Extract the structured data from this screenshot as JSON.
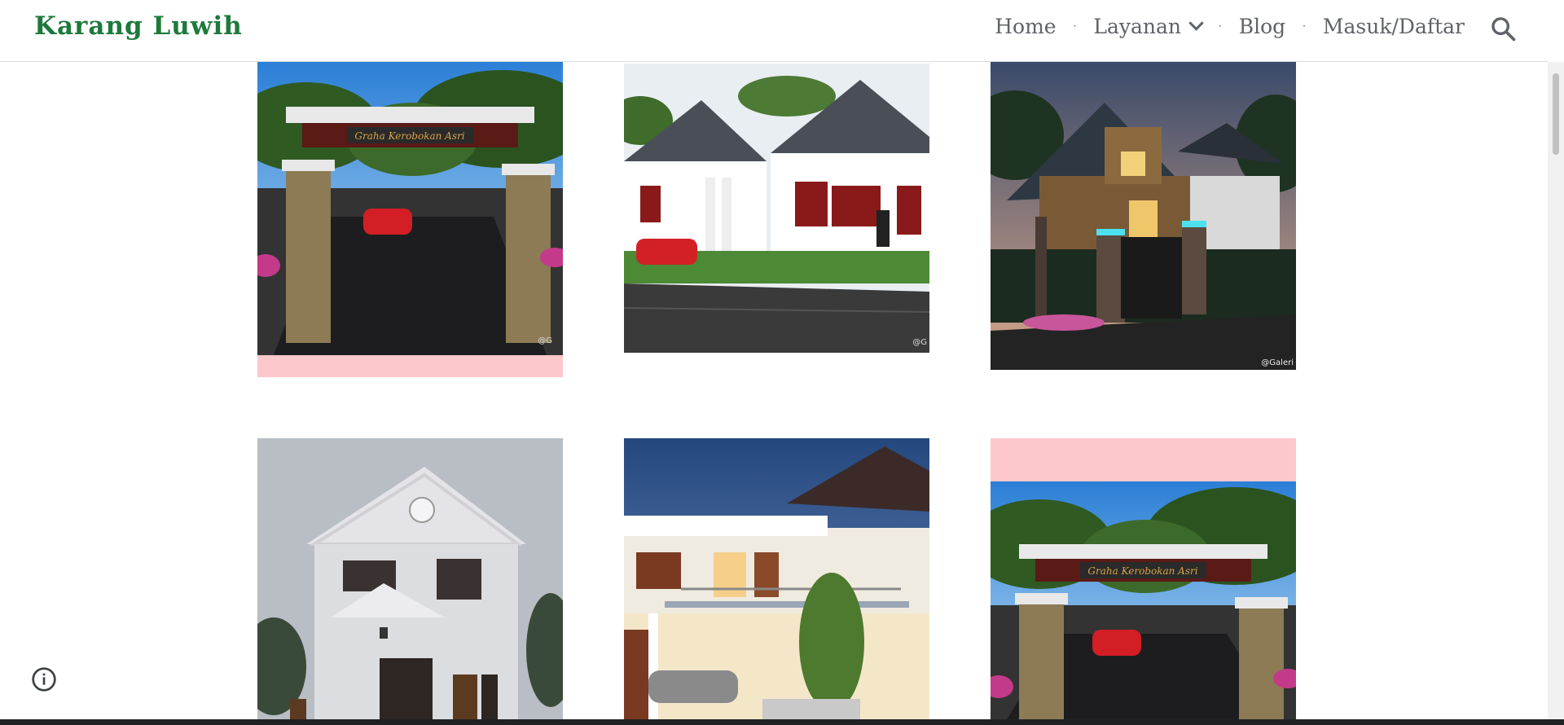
{
  "site": {
    "title": "Karang Luwih"
  },
  "nav": {
    "items": [
      {
        "label": "Home"
      },
      {
        "label": "Layanan"
      },
      {
        "label": "Blog"
      },
      {
        "label": "Masuk/Daftar"
      }
    ],
    "separator": "·"
  },
  "gallery": {
    "watermark": "@Galeri",
    "gate_sign": "Graha Kerobokan Asri"
  },
  "colors": {
    "brand_green": "#1e7a3c",
    "nav_text": "#5f6368",
    "pink_band": "#fcc8cc"
  },
  "icons": {
    "search": "search-icon",
    "dropdown": "chevron-down-icon",
    "info": "info-icon"
  }
}
